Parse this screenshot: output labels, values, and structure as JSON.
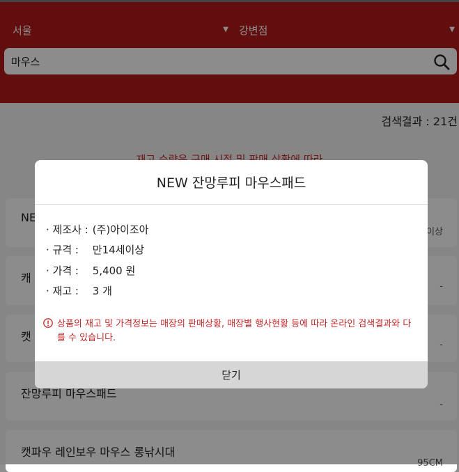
{
  "header": {
    "region_select": "서울",
    "store_select": "강변점",
    "search": {
      "value": "마우스"
    }
  },
  "results": {
    "count_text": "검색결과 : 21건"
  },
  "notice_text": "재고 수량은 구매 시점 및 판매 상황에 따라",
  "products": [
    {
      "name": "NE",
      "meta": "이상"
    },
    {
      "name": "캐",
      "meta": "-"
    },
    {
      "name": "캣",
      "meta": "-"
    },
    {
      "name": "잔망루피 마우스패드",
      "meta": "-"
    },
    {
      "name": "캣파우 레인보우 마우스 롱낚시대",
      "meta": "95CM"
    }
  ],
  "modal": {
    "title": "NEW 잔망루피 마우스패드",
    "rows": [
      {
        "label": "· 제조사 :",
        "value": "(주)아이조아"
      },
      {
        "label": "· 규격 :",
        "value": "만14세이상"
      },
      {
        "label": "· 가격 :",
        "value": "5,400 원"
      },
      {
        "label": "· 재고 :",
        "value": "3 개"
      }
    ],
    "warning": "상품의 재고 및 가격정보는 매장의 판매상황, 매장별 행사현황 등에 따라 온라인 검색결과와 다를 수 있습니다.",
    "close_label": "닫기"
  },
  "colors": {
    "brand_red": "#b51b1b",
    "warning_red": "#c62828"
  },
  "icons": {
    "search": "search-icon",
    "dropdown": "caret-down-icon",
    "warning": "exclamation-circle-icon"
  }
}
